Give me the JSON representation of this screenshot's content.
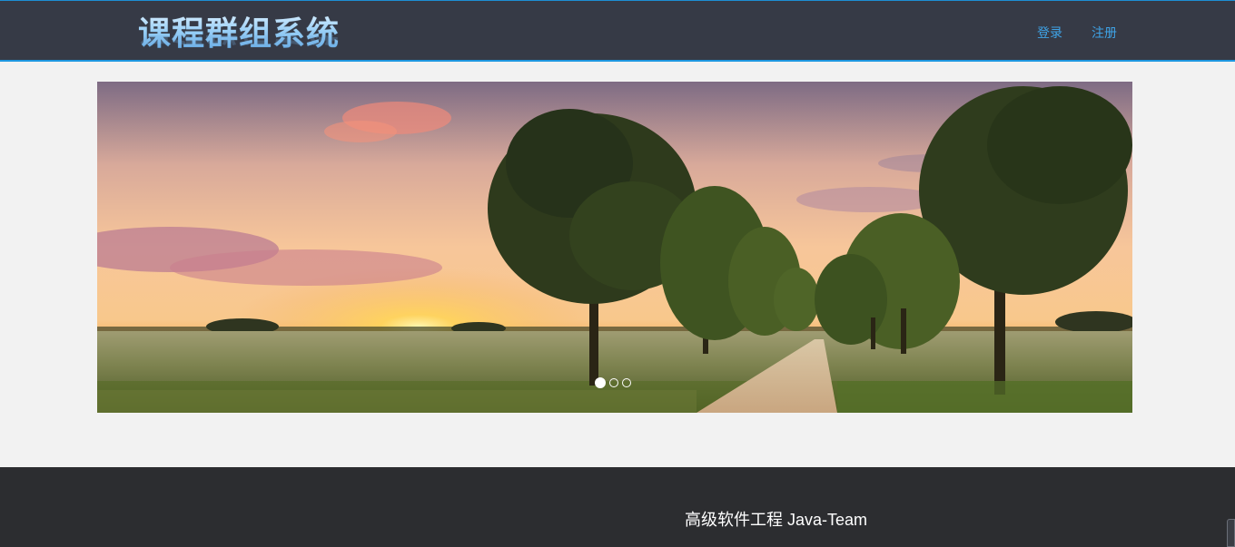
{
  "header": {
    "logo_text": "课程群组系统",
    "nav": {
      "login": "登录",
      "register": "注册"
    }
  },
  "carousel": {
    "slide_count": 3,
    "active_slide": 1,
    "image": "sunset-tree-lined-country-road"
  },
  "footer": {
    "text": "高级软件工程 Java-Team"
  },
  "colors": {
    "header_bg": "#363a46",
    "accent": "#1e97e0",
    "nav_link": "#3fa3e6",
    "page_bg": "#f2f2f2",
    "footer_bg": "#2c2d30"
  }
}
